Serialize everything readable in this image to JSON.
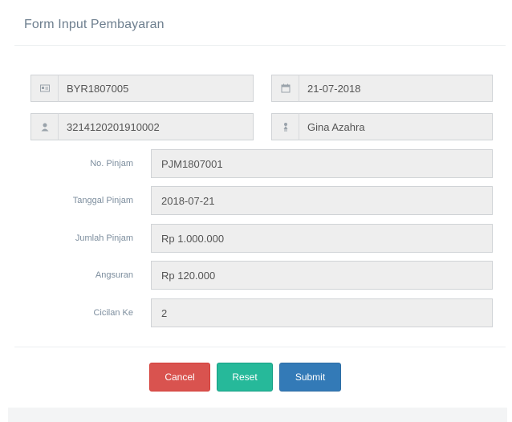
{
  "panel": {
    "title": "Form Input Pembayaran"
  },
  "top_fields": {
    "id_pembayaran": "BYR1807005",
    "tanggal": "21-07-2018",
    "nik": "3214120201910002",
    "nama": "Gina Azahra"
  },
  "icons": {
    "id": "id-card-icon",
    "calendar": "calendar-icon",
    "user": "user-icon",
    "gender": "female-icon"
  },
  "fields": [
    {
      "label": "No. Pinjam",
      "value": "PJM1807001"
    },
    {
      "label": "Tanggal Pinjam",
      "value": "2018-07-21"
    },
    {
      "label": "Jumlah Pinjam",
      "value": "Rp 1.000.000"
    },
    {
      "label": "Angsuran",
      "value": "Rp 120.000"
    },
    {
      "label": "Cicilan Ke",
      "value": "2"
    }
  ],
  "buttons": {
    "cancel": "Cancel",
    "reset": "Reset",
    "submit": "Submit"
  },
  "colors": {
    "cancel": "#d9534f",
    "reset": "#26b99a",
    "submit": "#337ab7",
    "field_bg": "#eeeeee",
    "label": "#7d8e9e"
  }
}
